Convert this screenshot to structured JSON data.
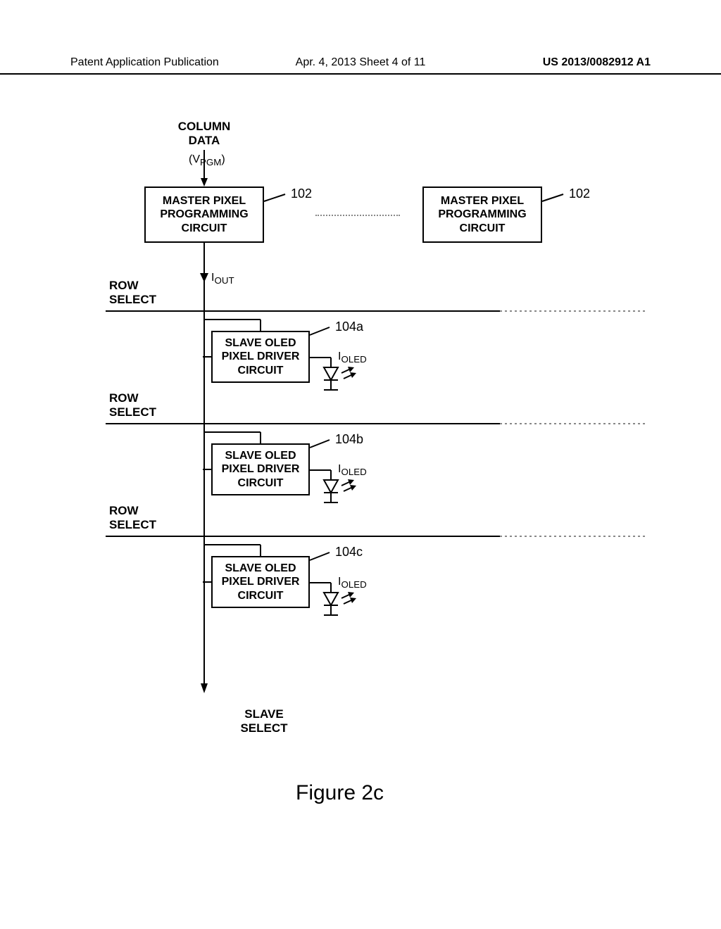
{
  "header": {
    "left": "Patent Application Publication",
    "center": "Apr. 4, 2013  Sheet 4 of 11",
    "right": "US 2013/0082912 A1"
  },
  "labels": {
    "column_data": "COLUMN\nDATA",
    "vpgm": "(V",
    "vpgm_sub": "PGM",
    "vpgm_close": ")",
    "iout": "I",
    "iout_sub": "OUT",
    "row_select": "ROW\nSELECT",
    "slave_select": "SLAVE\nSELECT",
    "ioled": "I",
    "ioled_sub": "OLED"
  },
  "boxes": {
    "master": "MASTER PIXEL\nPROGRAMMING\nCIRCUIT",
    "slave": "SLAVE OLED\nPIXEL DRIVER\nCIRCUIT"
  },
  "refs": {
    "r102": "102",
    "r104a": "104a",
    "r104b": "104b",
    "r104c": "104c"
  },
  "figure": "Figure 2c"
}
